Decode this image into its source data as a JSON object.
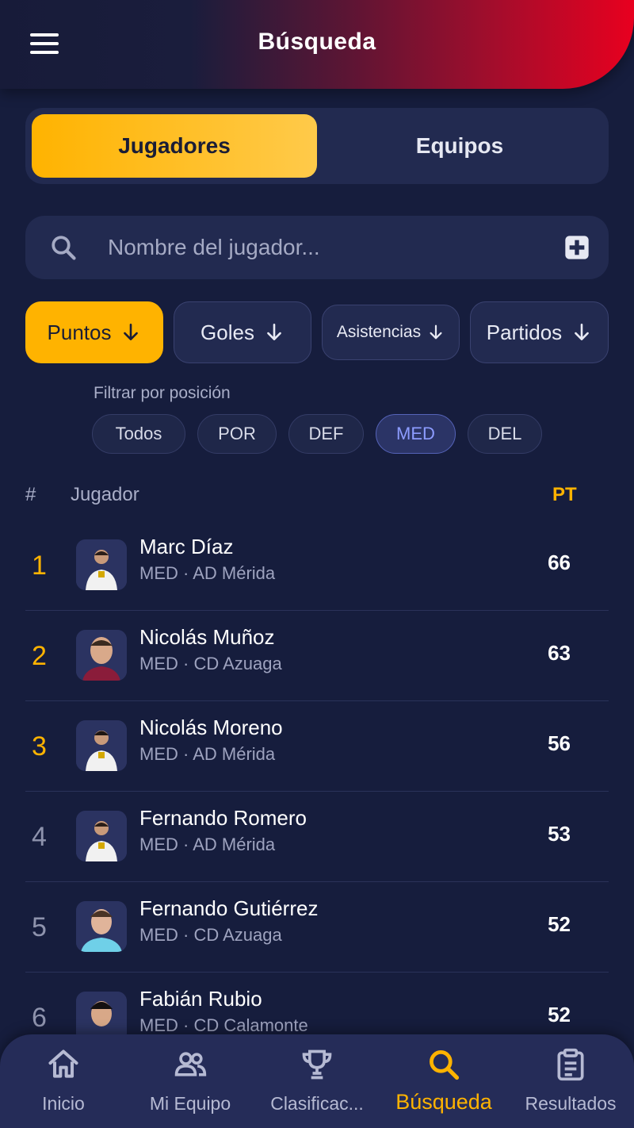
{
  "header": {
    "title": "Búsqueda",
    "menu_icon": "hamburger-menu-icon"
  },
  "tabs": [
    {
      "label": "Jugadores",
      "active": true
    },
    {
      "label": "Equipos",
      "active": false
    }
  ],
  "search": {
    "placeholder": "Nombre del jugador...",
    "value": "",
    "icon": "search-icon",
    "add_icon": "plus-square-icon"
  },
  "sort": [
    {
      "label": "Puntos",
      "active": true,
      "icon": "arrow-down-icon"
    },
    {
      "label": "Goles",
      "active": false,
      "icon": "arrow-down-icon"
    },
    {
      "label": "Asistencias",
      "active": false,
      "icon": "arrow-down-icon"
    },
    {
      "label": "Partidos",
      "active": false,
      "icon": "arrow-down-icon"
    }
  ],
  "filter": {
    "label": "Filtrar por posición",
    "positions": [
      {
        "label": "Todos",
        "active": false
      },
      {
        "label": "POR",
        "active": false
      },
      {
        "label": "DEF",
        "active": false
      },
      {
        "label": "MED",
        "active": true
      },
      {
        "label": "DEL",
        "active": false
      }
    ]
  },
  "table": {
    "headers": {
      "rank": "#",
      "player": "Jugador",
      "points": "PT"
    },
    "rows": [
      {
        "rank": "1",
        "name": "Marc Díaz",
        "info": "MED · AD Mérida",
        "points": "66"
      },
      {
        "rank": "2",
        "name": "Nicolás Muñoz",
        "info": "MED · CD Azuaga",
        "points": "63"
      },
      {
        "rank": "3",
        "name": "Nicolás Moreno",
        "info": "MED · AD Mérida",
        "points": "56"
      },
      {
        "rank": "4",
        "name": "Fernando Romero",
        "info": "MED · AD Mérida",
        "points": "53"
      },
      {
        "rank": "5",
        "name": "Fernando Gutiérrez",
        "info": "MED · CD Azuaga",
        "points": "52"
      },
      {
        "rank": "6",
        "name": "Fabián Rubio",
        "info": "MED · CD Calamonte",
        "points": "52"
      }
    ]
  },
  "bottom_nav": [
    {
      "label": "Inicio",
      "icon": "home-icon",
      "active": false
    },
    {
      "label": "Mi Equipo",
      "icon": "people-icon",
      "active": false
    },
    {
      "label": "Clasificac...",
      "icon": "trophy-icon",
      "active": false
    },
    {
      "label": "Búsqueda",
      "icon": "search-icon",
      "active": true
    },
    {
      "label": "Resultados",
      "icon": "clipboard-icon",
      "active": false
    }
  ],
  "colors": {
    "accent": "#ffb300",
    "brand_red": "#e8001f",
    "background": "#161d3d",
    "card": "#222a50"
  }
}
